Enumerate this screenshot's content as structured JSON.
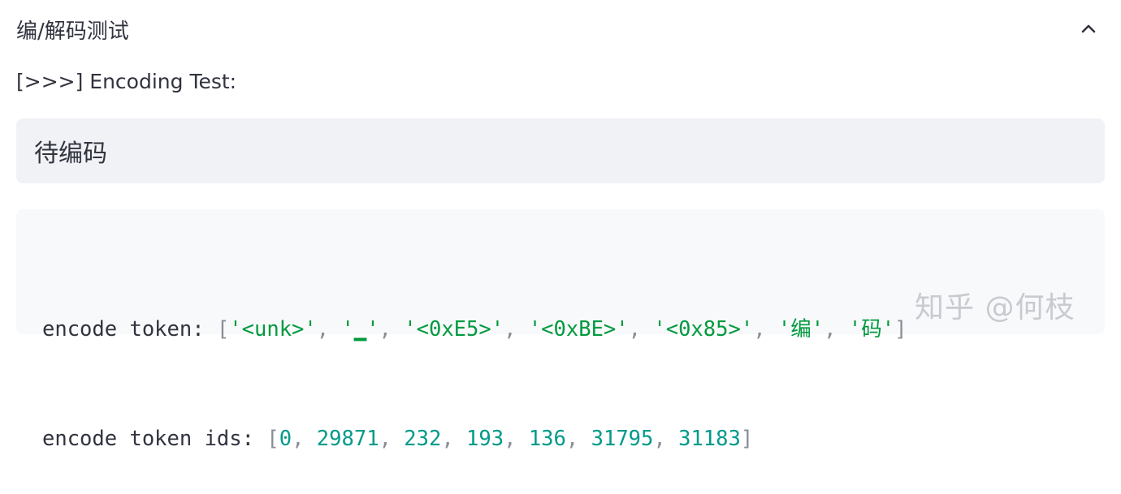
{
  "expander": {
    "title": "编/解码测试",
    "toggle_icon": "chevron-up-icon"
  },
  "caption": "[>>>] Encoding Test:",
  "input": {
    "value": "待编码"
  },
  "output": {
    "line1": {
      "label": "encode token: ",
      "items": [
        "'<unk>'",
        "'▁'",
        "'<0xE5>'",
        "'<0xBE>'",
        "'<0x85>'",
        "'编'",
        "'码'"
      ]
    },
    "line2": {
      "label": "encode token ids: ",
      "items": [
        "0",
        "29871",
        "232",
        "193",
        "136",
        "31795",
        "31183"
      ]
    }
  },
  "watermark": "知乎 @何枝",
  "colors": {
    "string": "#009a3e",
    "number": "#009a8a",
    "input_bg": "#f0f2f6",
    "code_bg": "#f8f9fb"
  }
}
